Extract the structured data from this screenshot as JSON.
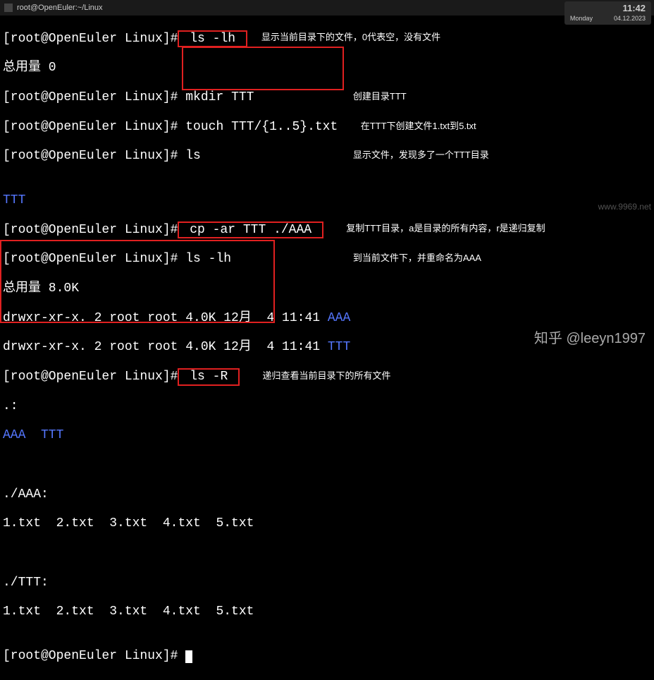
{
  "titlebar": {
    "title": "root@OpenEuler:~/Linux",
    "min": "—",
    "max": "▢",
    "close": "✕"
  },
  "clock": {
    "time": "11:42",
    "day": "Monday",
    "date": "04.12.2023"
  },
  "prompt": "[root@OpenEuler Linux]#",
  "lines": {
    "l1_cmd": " ls -lh ",
    "l1_ann": "显示当前目录下的文件，0代表空，没有文件",
    "l2": "总用量 0",
    "l3_cmd": " mkdir TTT",
    "l3_ann": "创建目录TTT",
    "l4_cmd": " touch TTT/{1..5}.txt",
    "l4_ann": "在TTT下创建文件1.txt到5.txt",
    "l5_cmd": " ls",
    "l5_ann": "显示文件，发现多了一个TTT目录",
    "l6": "TTT",
    "l7_cmd": " cp -ar TTT ./AAA ",
    "l7_ann": "复制TTT目录，a是目录的所有内容，r是递归复制",
    "l8_cmd": " ls -lh",
    "l8_ann": "到当前文件下，并重命名为AAA",
    "l9": "总用量 8.0K",
    "l10a": "drwxr-xr-x. 2 root root 4.0K 12月  4 11:41 ",
    "l10b": "AAA",
    "l11a": "drwxr-xr-x. 2 root root 4.0K 12月  4 11:41 ",
    "l11b": "TTT",
    "l12_cmd": " ls -R ",
    "l12_ann": "递归查看当前目录下的所有文件",
    "l13": ".:",
    "l14": "AAA  TTT",
    "l15": "",
    "l16": "./AAA:",
    "l17": "1.txt  2.txt  3.txt  4.txt  5.txt",
    "l18": "",
    "l19": "./TTT:",
    "l20": "1.txt  2.txt  3.txt  4.txt  5.txt"
  },
  "watermark": {
    "zhihu": "知乎 @leeyn1997",
    "site": "www.9969.net"
  }
}
